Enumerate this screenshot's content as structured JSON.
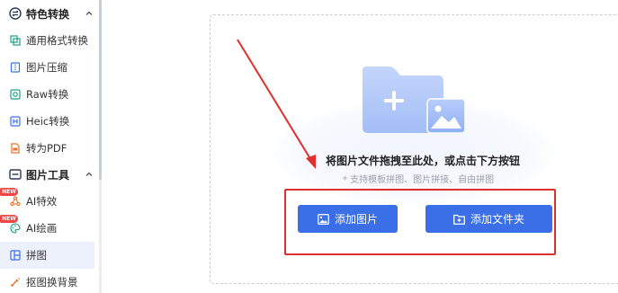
{
  "sidebar": {
    "sections": [
      {
        "label": "特色转换"
      },
      {
        "label": "图片工具"
      }
    ],
    "items": [
      {
        "label": "通用格式转换"
      },
      {
        "label": "图片压缩"
      },
      {
        "label": "Raw转换"
      },
      {
        "label": "Heic转换"
      },
      {
        "label": "转为PDF"
      },
      {
        "label": "AI特效",
        "badge": "NEW"
      },
      {
        "label": "AI绘画",
        "badge": "NEW"
      },
      {
        "label": "拼图"
      },
      {
        "label": "抠图换背景"
      }
    ]
  },
  "dropzone": {
    "title": "将图片文件拖拽至此处，或点击下方按钮",
    "subtitle": "* 支持模板拼图、图片拼接、自由拼图",
    "add_image_label": "添加图片",
    "add_folder_label": "添加文件夹"
  },
  "colors": {
    "accent": "#3a6fe8",
    "highlight_box": "#e02f2f",
    "badge": "#ef4444",
    "active_bg": "#ecf1fb"
  }
}
